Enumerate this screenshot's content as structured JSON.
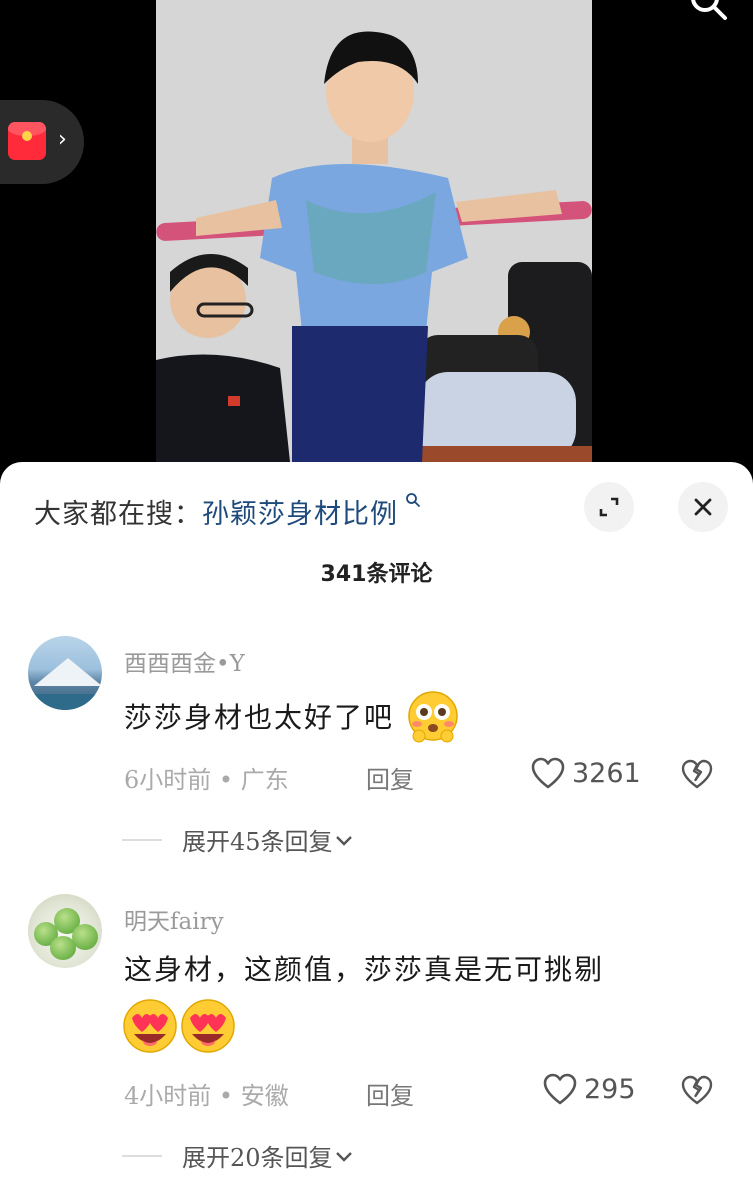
{
  "video": {
    "search_icon": "search-icon",
    "redpacket_icon": "red-envelope-icon",
    "redpacket_chevron": "›"
  },
  "sheet": {
    "search_prefix": "大家都在搜：",
    "search_term": "孙颖莎身材比例",
    "search_suffix_icon": "magnifier-icon",
    "comment_count": "341条评论",
    "expand_icon": "expand-icon",
    "close_icon": "close-icon"
  },
  "comments": [
    {
      "username": "酉酉酉金•Y",
      "text": "莎莎身材也太好了吧",
      "emoji": "flushed-face-emoji",
      "time": "6小时前",
      "location": "广东",
      "reply_label": "回复",
      "likes": "3261",
      "expand_replies": "展开45条回复"
    },
    {
      "username": "明天fairy",
      "text": "这身材，这颜值，莎莎真是无可挑剔",
      "emoji": "heart-eyes-emoji",
      "time": "4小时前",
      "location": "安徽",
      "reply_label": "回复",
      "likes": "295",
      "expand_replies": "展开20条回复"
    }
  ],
  "meta_separator": "•",
  "colors": {
    "search_term": "#1f4a7c",
    "sheet_bg": "#ffffff",
    "muted_text": "#aaaaaa"
  }
}
